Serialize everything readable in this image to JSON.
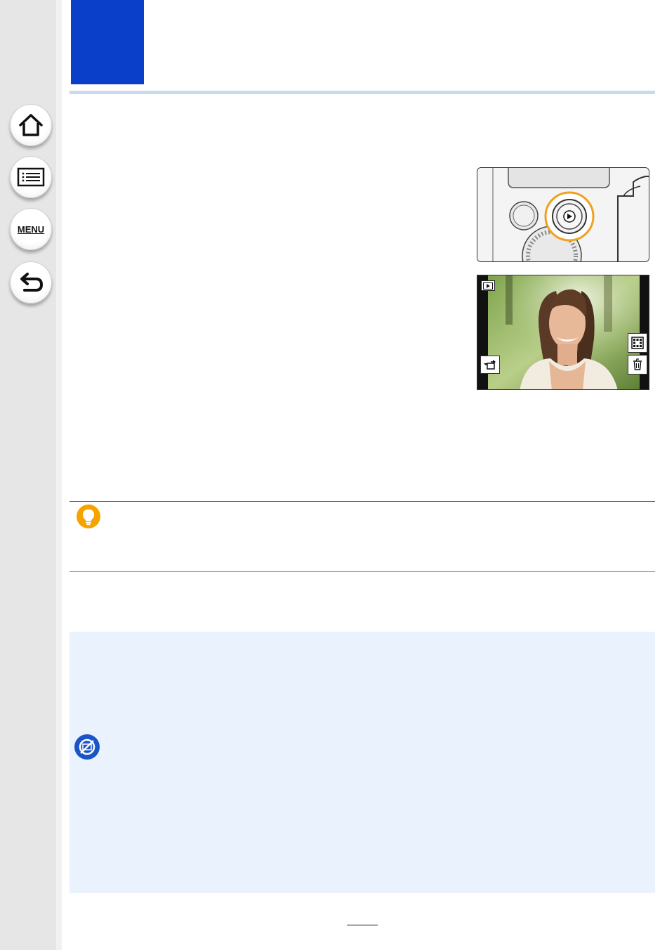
{
  "sidebar": {
    "buttons": [
      {
        "name": "home",
        "icon": "home-icon"
      },
      {
        "name": "contents",
        "icon": "list-icon"
      },
      {
        "name": "menu",
        "icon": "menu-icon",
        "label": "MENU"
      },
      {
        "name": "back",
        "icon": "back-arrow-icon"
      }
    ]
  },
  "chapter": {
    "accent_color": "#0a3fc9",
    "rule_color": "#c9d9ef"
  },
  "figures": {
    "playback_button": {
      "description_icon": "playback-button-icon",
      "highlight_color": "#f0a020"
    },
    "playback_screen": {
      "left_icons": [
        "playback-mode-icon",
        "send-image-icon"
      ],
      "right_icons": [
        "multi-playback-icon",
        "delete-icon"
      ]
    }
  },
  "tip": {
    "icon": "lightbulb-icon",
    "color": "#f5a300"
  },
  "note": {
    "icon": "not-available-icon",
    "color": "#1a55c8",
    "panel_color": "#eaf3fd"
  },
  "page": {
    "number": ""
  }
}
